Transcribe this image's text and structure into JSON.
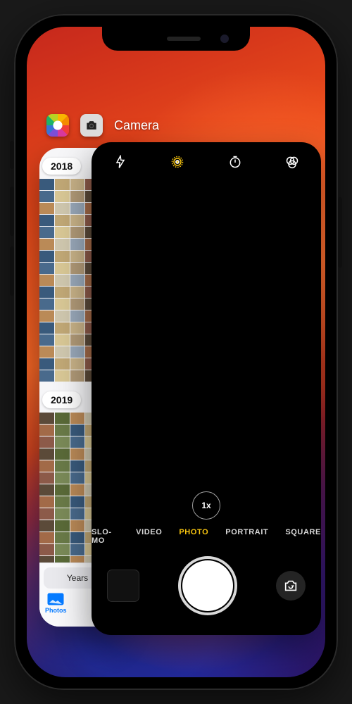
{
  "switcher": {
    "apps": [
      {
        "id": "photos",
        "title": "Photos"
      },
      {
        "id": "camera",
        "title": "Camera"
      }
    ],
    "foreground_title": "Camera"
  },
  "photos_card": {
    "year_chips": [
      "2018",
      "2019"
    ],
    "segmented_visible": "Years",
    "active_tab_label": "Photos"
  },
  "camera_card": {
    "top_icons": {
      "flash": "flash-icon",
      "live": "live-photo-icon",
      "timer": "timer-icon",
      "filters": "filters-icon"
    },
    "zoom_label": "1x",
    "modes": [
      "SLO-MO",
      "VIDEO",
      "PHOTO",
      "PORTRAIT",
      "SQUARE"
    ],
    "active_mode": "PHOTO"
  },
  "colors": {
    "accent_yellow": "#f5c518",
    "ios_blue": "#0a7aff"
  }
}
